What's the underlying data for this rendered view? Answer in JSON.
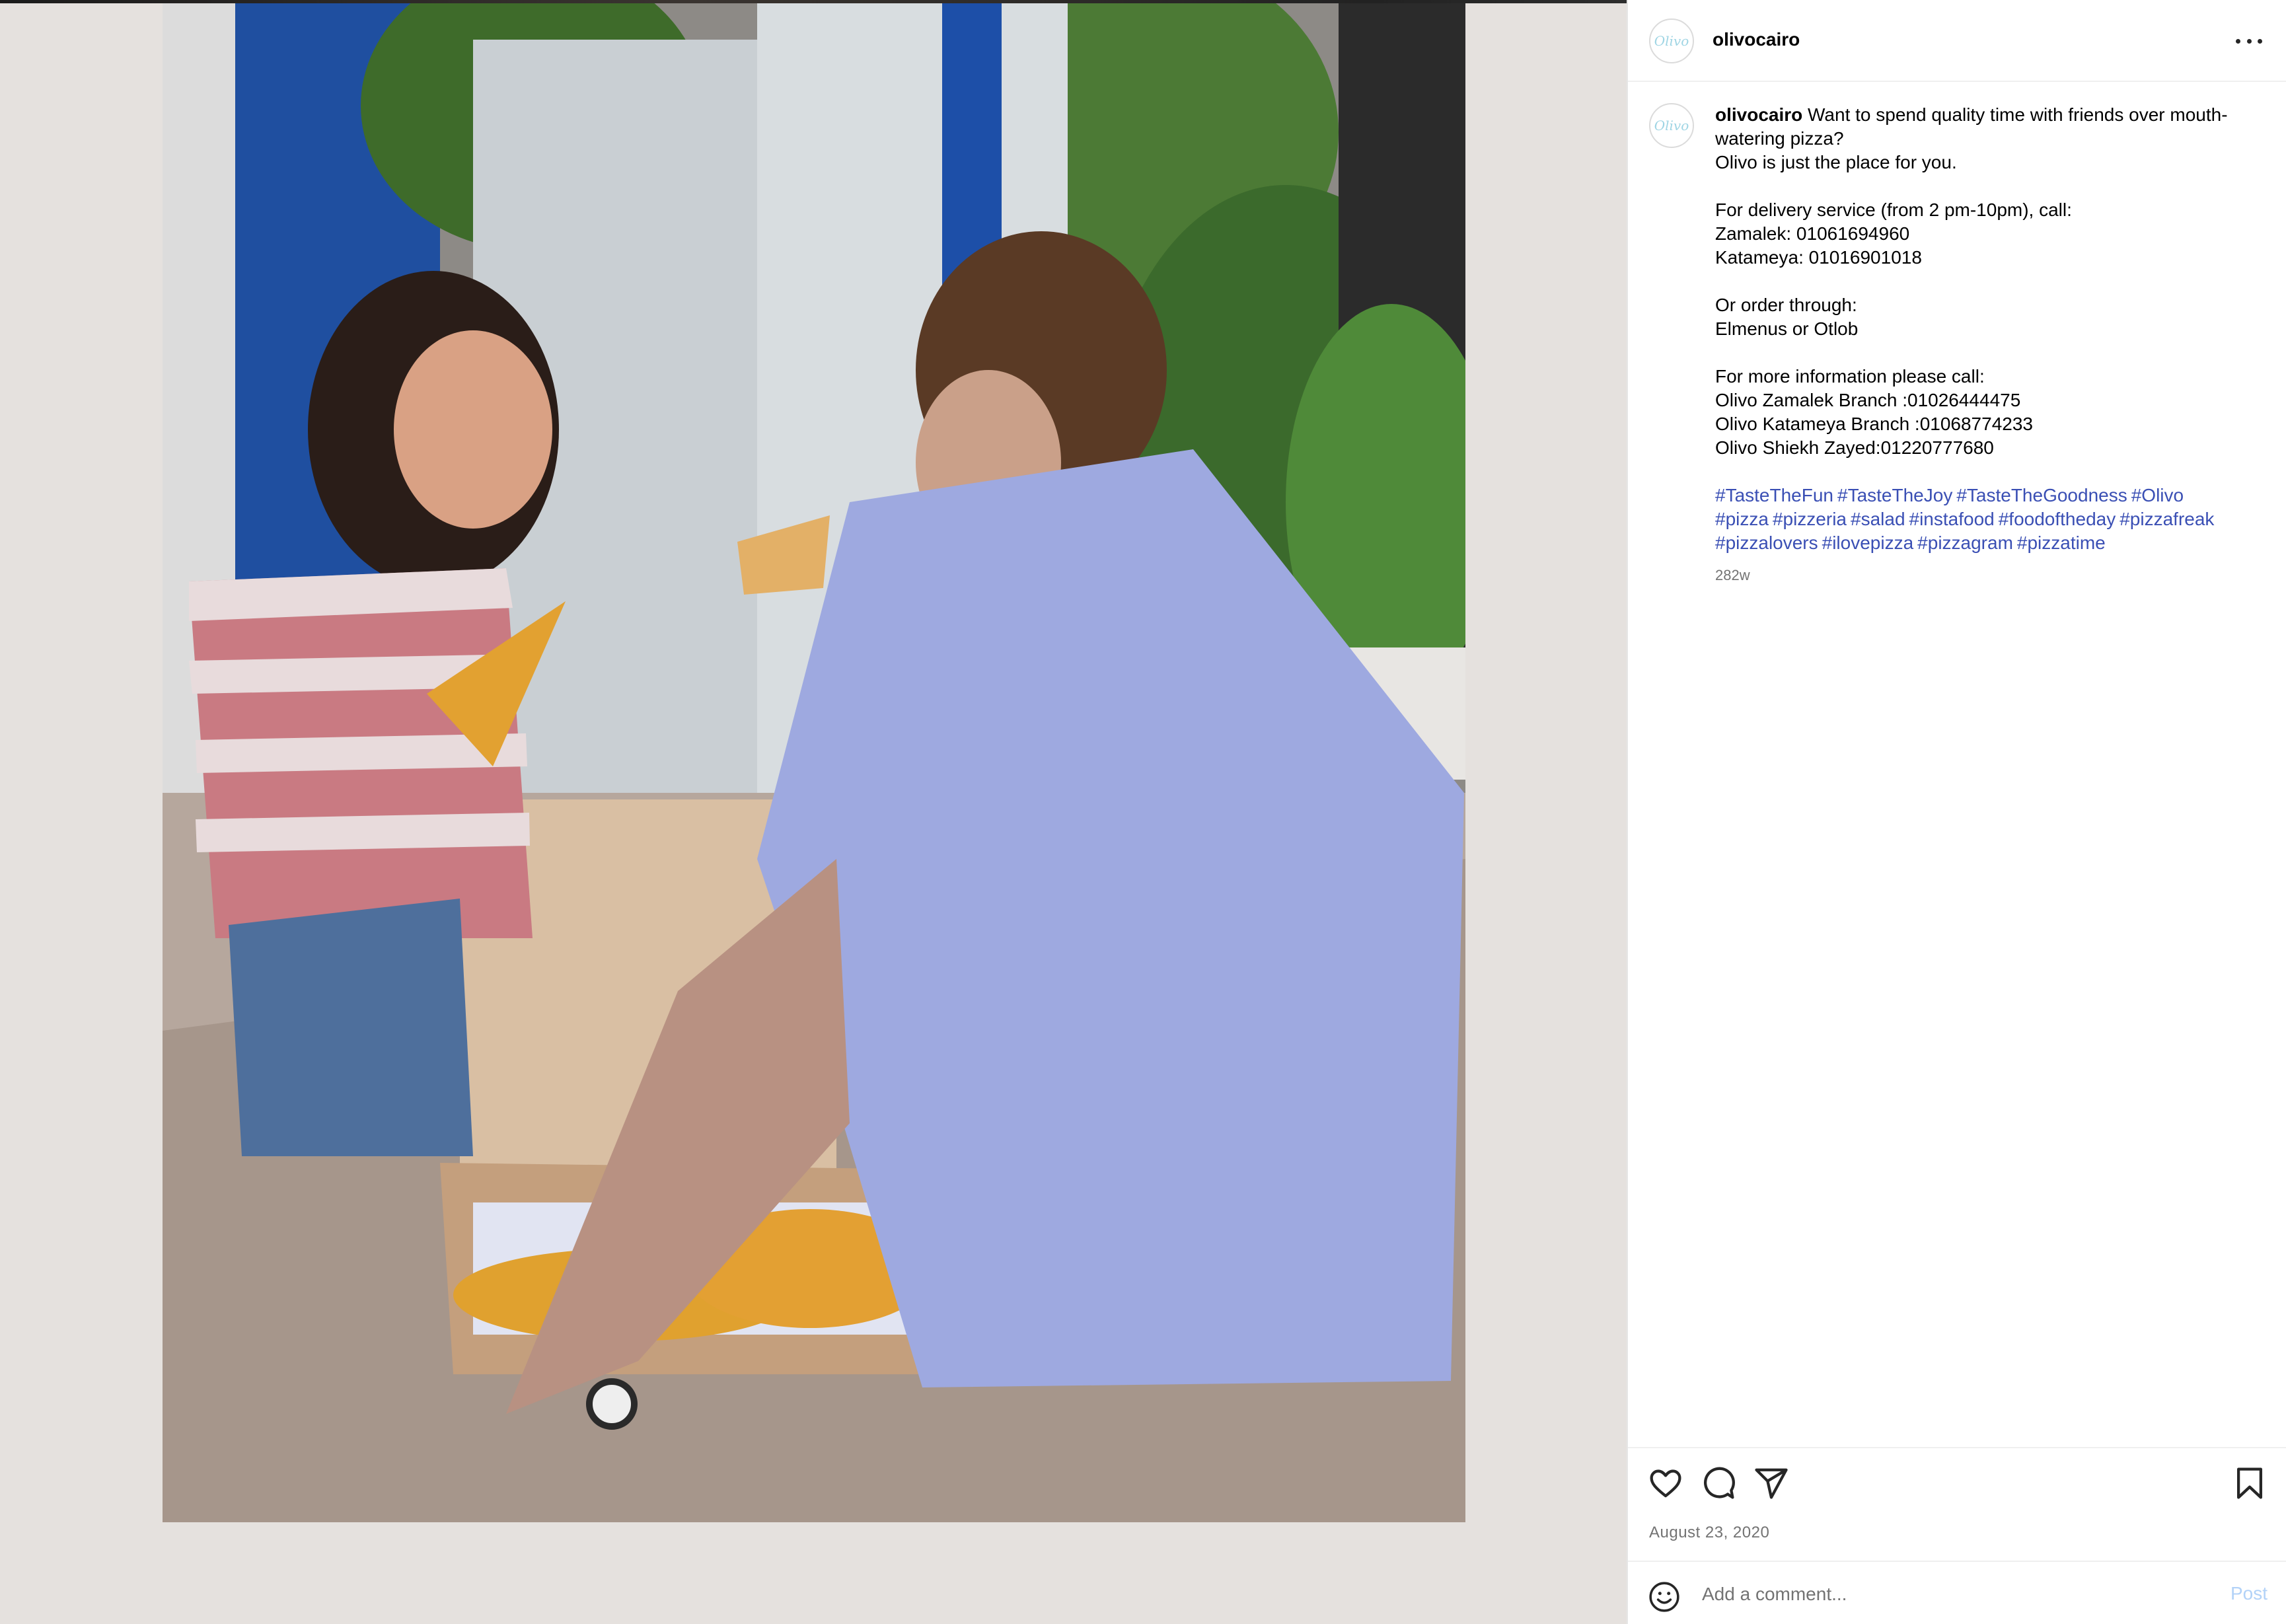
{
  "post": {
    "username": "olivocairo",
    "avatar_text": "Olivo",
    "caption_user": "olivocairo",
    "caption_lines": [
      "Want to spend quality time with friends over mouth-",
      "watering pizza?",
      "Olivo is just the place for you.",
      "",
      "For delivery service (from 2 pm-10pm), call:",
      "Zamalek: 01061694960",
      "Katameya: 01016901018",
      "",
      "Or order through:",
      "Elmenus or Otlob",
      "",
      "For more information please call:",
      "Olivo Zamalek Branch :01026444475",
      "Olivo Katameya Branch :01068774233",
      "Olivo Shiekh Zayed:01220777680",
      ""
    ],
    "hashtag_lines": [
      [
        "#TasteTheFun",
        "#TasteTheJoy",
        "#TasteTheGoodness",
        "#Olivo"
      ],
      [
        "#pizza",
        "#pizzeria",
        "#salad",
        "#instafood",
        "#foodoftheday",
        "#pizzafreak"
      ],
      [
        "#pizzalovers",
        "#ilovepizza",
        "#pizzagram",
        "#pizzatime"
      ]
    ],
    "age": "282w",
    "date": "August 23, 2020"
  },
  "actions": {
    "like_icon": "heart-icon",
    "comment_icon": "comment-bubble-icon",
    "share_icon": "paper-plane-icon",
    "save_icon": "bookmark-icon"
  },
  "comment": {
    "placeholder": "Add a comment...",
    "post_label": "Post",
    "emoji_icon": "smiley-icon"
  },
  "colors": {
    "hashtag": "#3a4fb4",
    "post_disabled": "#b2d2f8",
    "muted": "#737373"
  }
}
